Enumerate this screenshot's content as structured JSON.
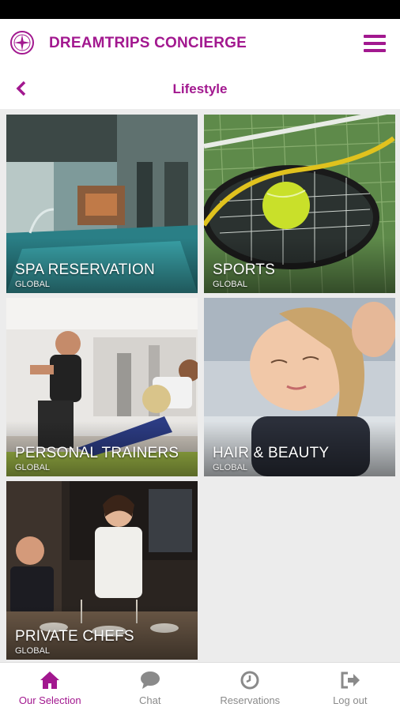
{
  "app": {
    "title": "DREAMTRIPS CONCIERGE",
    "accent_color": "#a2188f"
  },
  "page": {
    "title": "Lifestyle",
    "back_icon": "chevron-left-icon",
    "menu_icon": "hamburger-menu-icon"
  },
  "tiles": [
    {
      "title": "SPA RESERVATION",
      "subtitle": "GLOBAL"
    },
    {
      "title": "SPORTS",
      "subtitle": "GLOBAL"
    },
    {
      "title": "PERSONAL TRAINERS",
      "subtitle": "GLOBAL"
    },
    {
      "title": "HAIR & BEAUTY",
      "subtitle": "GLOBAL"
    },
    {
      "title": "PRIVATE CHEFS",
      "subtitle": "GLOBAL"
    }
  ],
  "nav": {
    "items": [
      {
        "label": "Our Selection",
        "icon": "home-icon",
        "active": true
      },
      {
        "label": "Chat",
        "icon": "chat-bubble-icon",
        "active": false
      },
      {
        "label": "Reservations",
        "icon": "clock-icon",
        "active": false
      },
      {
        "label": "Log out",
        "icon": "logout-icon",
        "active": false
      }
    ]
  }
}
